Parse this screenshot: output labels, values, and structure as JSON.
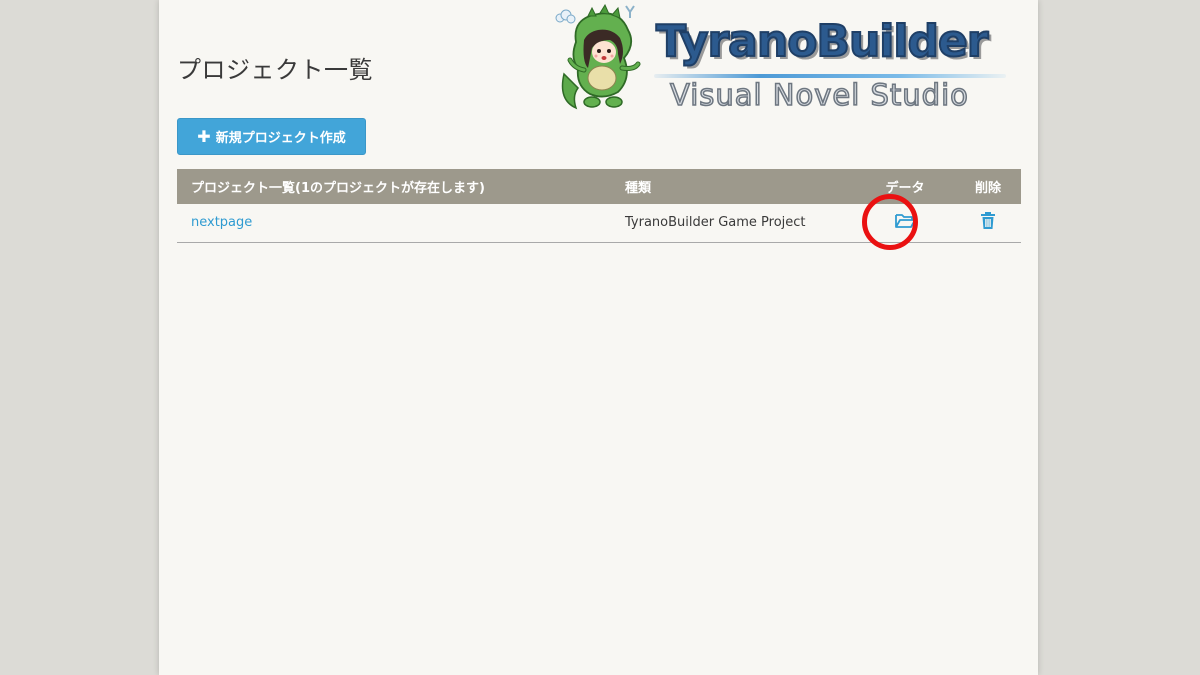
{
  "page": {
    "title": "プロジェクト一覧"
  },
  "logo": {
    "title": "TyranoBuilder",
    "subtitle": "Visual Novel Studio",
    "icon": "dinosaur-mascot-icon"
  },
  "toolbar": {
    "new_project_label": "新規プロジェクト作成",
    "new_project_icon": "plus-icon"
  },
  "table": {
    "headers": {
      "name": "プロジェクト一覧(1のプロジェクトが存在します)",
      "type": "種類",
      "data": "データ",
      "delete": "削除"
    },
    "rows": [
      {
        "name": "nextpage",
        "type": "TyranoBuilder Game Project",
        "data_icon": "folder-open-icon",
        "delete_icon": "trash-icon"
      }
    ]
  },
  "colors": {
    "accent": "#42a5d9",
    "link": "#2f9bd1",
    "header_bg": "#9d998c",
    "highlight": "#ea1111",
    "page_bg": "#f8f7f3",
    "outer_bg": "#dcdbd6"
  }
}
